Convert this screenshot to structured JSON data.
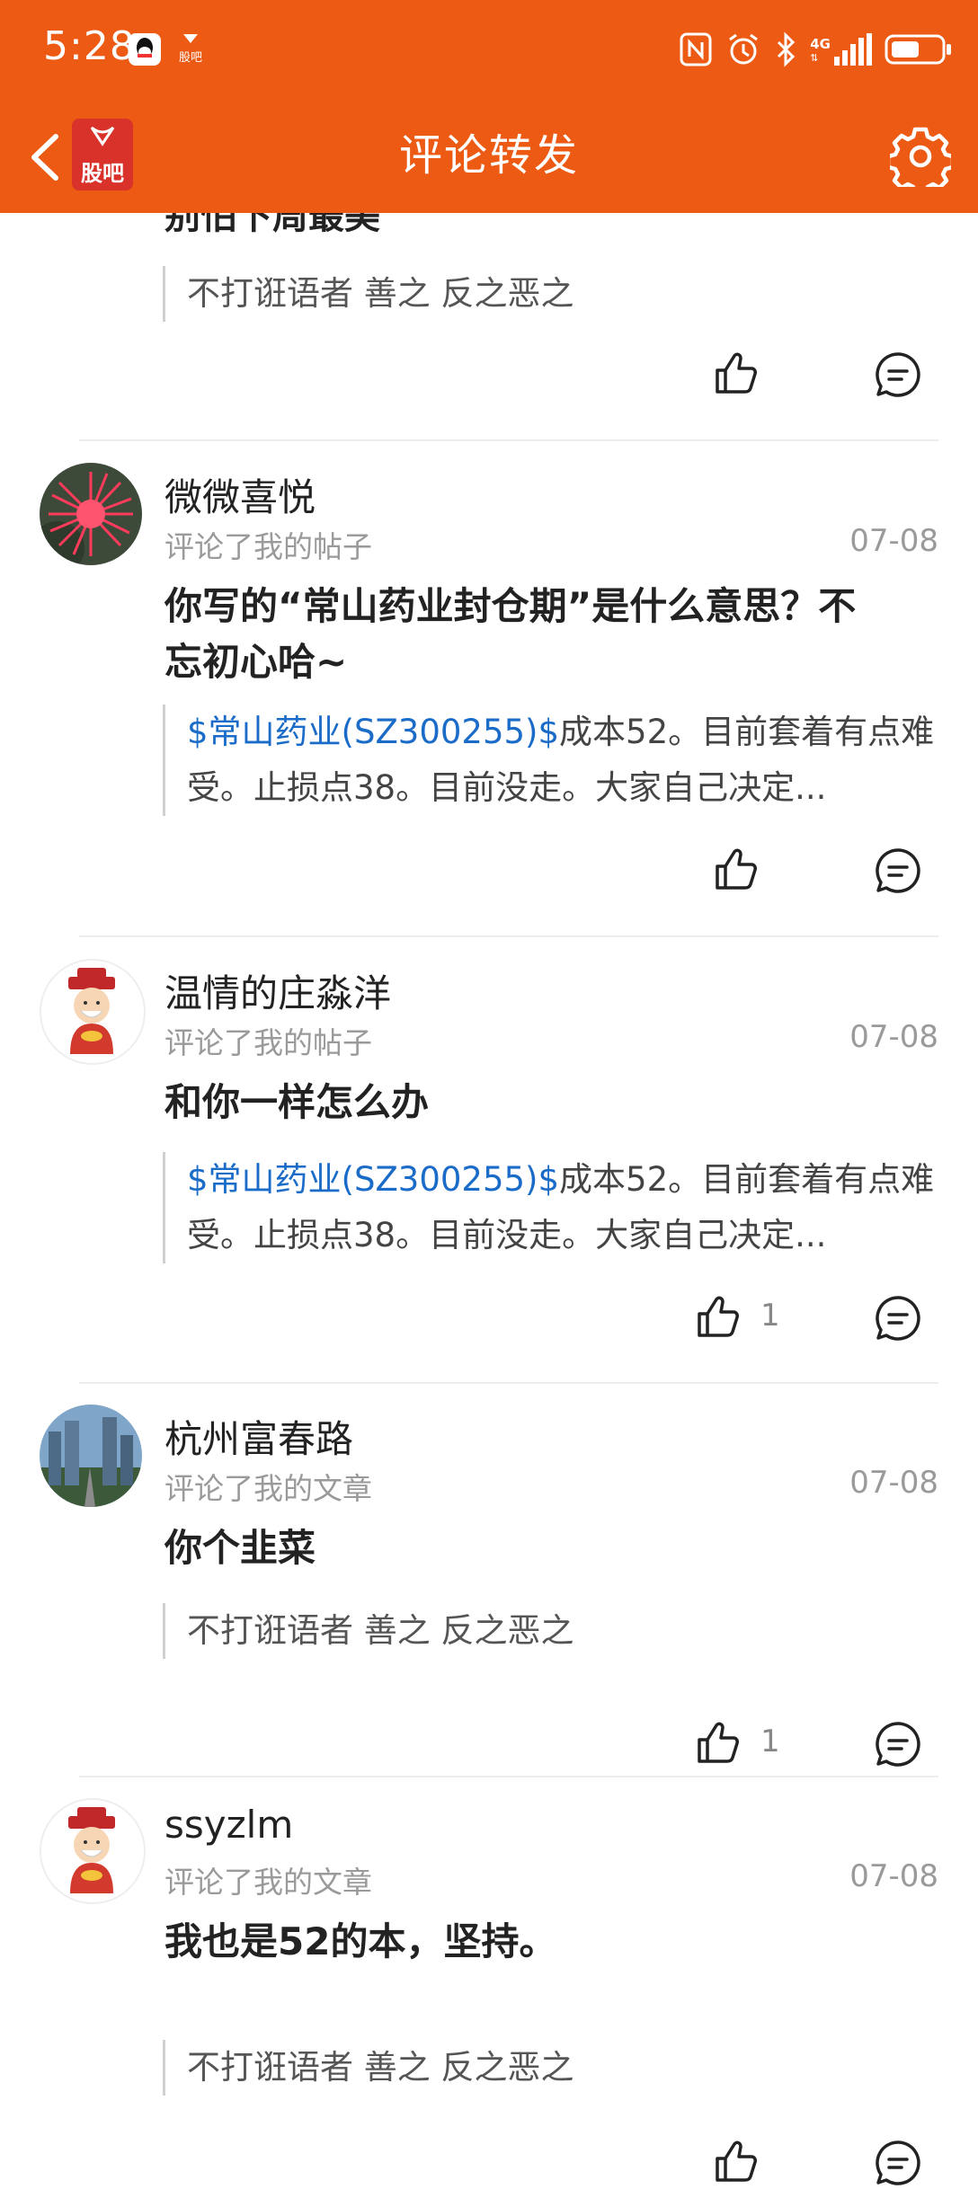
{
  "status_bar": {
    "time": "5:28",
    "network": "4G"
  },
  "header": {
    "logo_text": "股吧",
    "title": "评论转发"
  },
  "partial_item": {
    "title": "别怕下周最美",
    "quote": "不打诳语者 善之 反之恶之"
  },
  "items": [
    {
      "username": "微微喜悦",
      "subtitle": "评论了我的帖子",
      "date": "07-08",
      "comment": "你写的“常山药业封仓期”是什么意思？不忘初心哈~",
      "quote_stock": "$常山药业(SZ300255)$",
      "quote_text": "成本52。目前套着有点难受。止损点38。目前没走。大家自己决定...",
      "likes": ""
    },
    {
      "username": "温情的庄淼洋",
      "subtitle": "评论了我的帖子",
      "date": "07-08",
      "comment": "和你一样怎么办",
      "quote_stock": "$常山药业(SZ300255)$",
      "quote_text": "成本52。目前套着有点难受。止损点38。目前没走。大家自己决定...",
      "likes": "1"
    },
    {
      "username": "杭州富春路",
      "subtitle": "评论了我的文章",
      "date": "07-08",
      "comment": "你个韭菜",
      "quote_stock": "",
      "quote_text": "不打诳语者 善之 反之恶之",
      "likes": "1"
    },
    {
      "username": "ssyzlm",
      "subtitle": "评论了我的文章",
      "date": "07-08",
      "comment": "我也是52的本，坚持。",
      "quote_stock": "",
      "quote_text": "不打诳语者 善之 反之恶之",
      "likes": ""
    }
  ],
  "colors": {
    "brand": "#ec5a13",
    "link": "#1a6cc8"
  }
}
